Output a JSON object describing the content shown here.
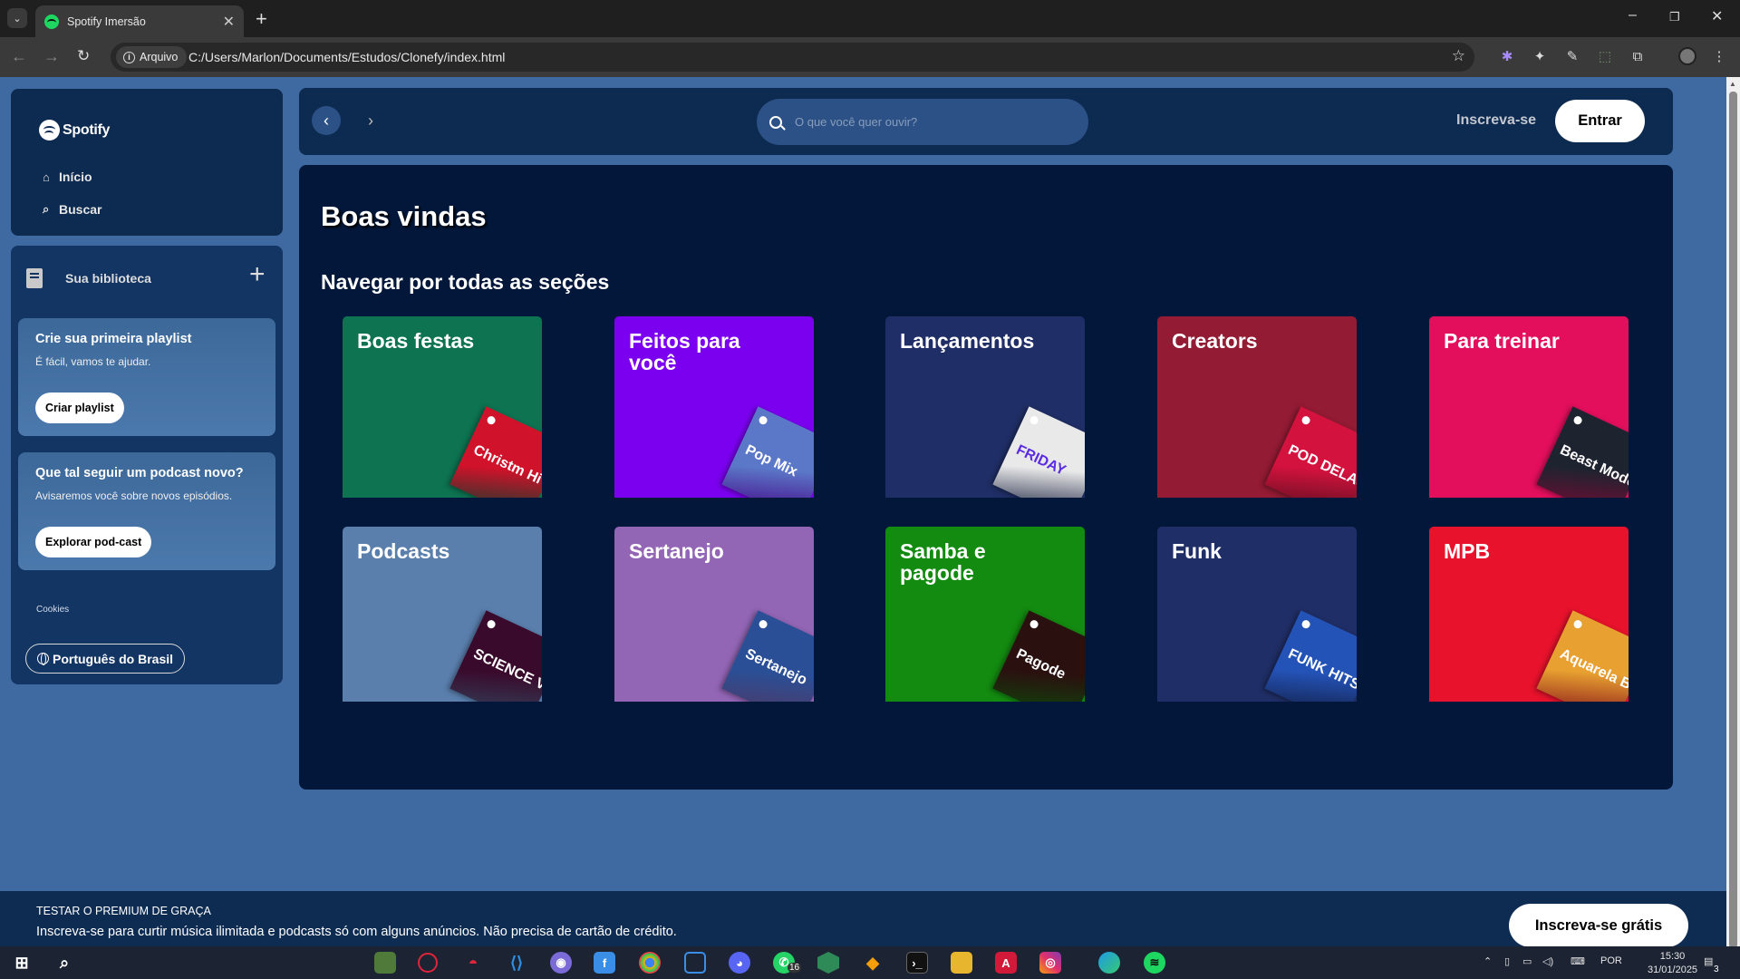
{
  "browser": {
    "tab_title": "Spotify Imersão",
    "site_chip": "Arquivo",
    "url": "C:/Users/Marlon/Documents/Estudos/Clonefy/index.html"
  },
  "sidebar": {
    "logo_text": "Spotify",
    "nav": [
      {
        "label": "Início",
        "icon": "home-icon"
      },
      {
        "label": "Buscar",
        "icon": "search-icon"
      }
    ],
    "library": {
      "title": "Sua biblioteca",
      "cards": [
        {
          "title": "Crie sua primeira playlist",
          "subtitle": "É fácil, vamos te ajudar.",
          "button": "Criar playlist"
        },
        {
          "title": "Que tal seguir um podcast novo?",
          "subtitle": "Avisaremos você sobre novos episódios.",
          "button": "Explorar pod-cast"
        }
      ],
      "cookies": "Cookies",
      "language_button": "Português do Brasil"
    }
  },
  "header": {
    "search_placeholder": "O que você quer ouvir?",
    "signup_link": "Inscreva-se",
    "login_button": "Entrar"
  },
  "main": {
    "greeting": "Boas vindas",
    "section_title": "Navegar por todas as seções",
    "categories": [
      {
        "label": "Boas festas",
        "color": "#0d7351",
        "cover_text": "Christm Hi",
        "cover_color": "#d0122a"
      },
      {
        "label": "Feitos para você",
        "color": "#7b00f0",
        "cover_text": "Pop Mix",
        "cover_color": "#5b78c8"
      },
      {
        "label": "Lançamentos",
        "color": "#1f2e66",
        "cover_text": "FRIDAY",
        "cover_color": "#e9e9e9"
      },
      {
        "label": "Creators",
        "color": "#931b33",
        "cover_text": "POD DELAS",
        "cover_color": "#d4123e"
      },
      {
        "label": "Para treinar",
        "color": "#e30f5d",
        "cover_text": "Beast Mode",
        "cover_color": "#1d2430"
      },
      {
        "label": "Podcasts",
        "color": "#5a7fad",
        "cover_text": "SCIENCE VS",
        "cover_color": "#3a0a2c"
      },
      {
        "label": "Sertanejo",
        "color": "#9265b5",
        "cover_text": "Sertanejo",
        "cover_color": "#2a4f96"
      },
      {
        "label": "Samba e pagode",
        "color": "#138a10",
        "cover_text": "Pagode",
        "cover_color": "#2b1010"
      },
      {
        "label": "Funk",
        "color": "#1f2e66",
        "cover_text": "FUNK HITS",
        "cover_color": "#2453b8"
      },
      {
        "label": "MPB",
        "color": "#e8122c",
        "cover_text": "Aquarela Brasileira",
        "cover_color": "#e8a030"
      }
    ]
  },
  "banner": {
    "top_line": "TESTAR O PREMIUM DE GRAÇA",
    "sub_line": "Inscreva-se para curtir música ilimitada e podcasts só com alguns anúncios. Não precisa de cartão de crédito.",
    "button": "Inscreva-se grátis"
  },
  "taskbar": {
    "language": "POR",
    "time": "15:30",
    "date": "31/01/2025",
    "whatsapp_badge": "16",
    "notifications": "3"
  }
}
